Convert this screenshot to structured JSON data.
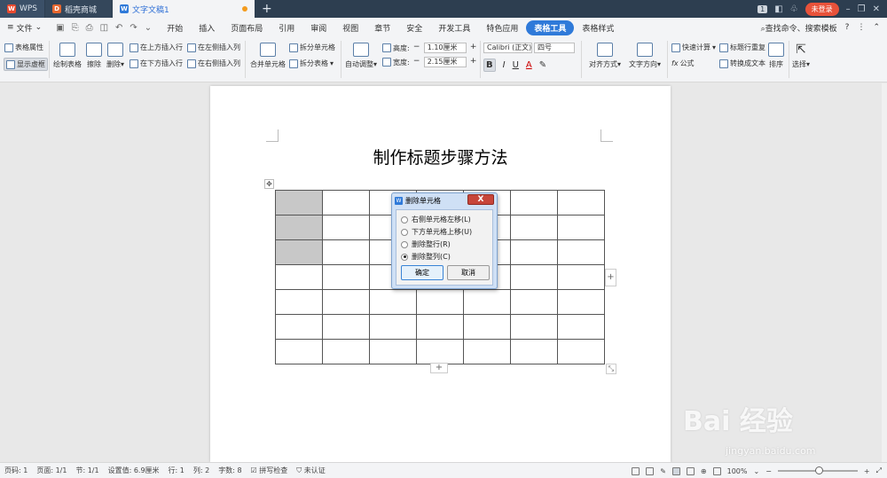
{
  "titlebar": {
    "tabs": [
      {
        "label": "WPS",
        "icon": "wps-logo-icon"
      },
      {
        "label": "稻壳商城",
        "icon": "docer-logo-icon"
      },
      {
        "label": "文字文稿1",
        "icon": "writer-doc-icon"
      }
    ],
    "badge": "1",
    "login_label": "未登录"
  },
  "menubar": {
    "file_label": "文件",
    "items": [
      "开始",
      "插入",
      "页面布局",
      "引用",
      "审阅",
      "视图",
      "章节",
      "安全",
      "开发工具",
      "特色应用",
      "表格工具",
      "表格样式"
    ],
    "active": "表格工具",
    "search_label": "查找命令、搜索模板"
  },
  "ribbon": {
    "table_props": "表格属性",
    "show_gridlines": "显示虚框",
    "draw_table": "绘制表格",
    "eraser": "擦除",
    "delete": "删除",
    "insert_above": "在上方插入行",
    "insert_below": "在下方插入行",
    "insert_left": "在左侧插入列",
    "insert_right": "在右侧插入列",
    "merge_cells": "合并单元格",
    "split_cells": "拆分单元格",
    "split_table": "拆分表格",
    "auto_fit": "自动调整",
    "height_label": "高度:",
    "height_value": "1.10厘米",
    "width_label": "宽度:",
    "width_value": "2.15厘米",
    "font_name": "Calibri (正文)",
    "font_size": "四号",
    "bold": "B",
    "italic": "I",
    "underline": "U",
    "font_color": "A",
    "align": "对齐方式",
    "text_direction": "文字方向",
    "quick_calc": "快速计算",
    "repeat_header": "标题行重复",
    "formula": "公式",
    "convert_text": "转换成文本",
    "sort": "排序",
    "select": "选择"
  },
  "document": {
    "title": "制作标题步骤方法",
    "table": {
      "rows": 7,
      "cols": 7,
      "selected": [
        [
          0,
          0
        ],
        [
          1,
          0
        ],
        [
          2,
          0
        ]
      ]
    }
  },
  "dialog": {
    "title": "删除单元格",
    "close": "X",
    "options": [
      {
        "label": "右侧单元格左移(L)",
        "checked": false
      },
      {
        "label": "下方单元格上移(U)",
        "checked": false
      },
      {
        "label": "删除整行(R)",
        "checked": false
      },
      {
        "label": "删除整列(C)",
        "checked": true
      }
    ],
    "ok_label": "确定",
    "cancel_label": "取消"
  },
  "statusbar": {
    "page_num": "页码: 1",
    "pages": "页面: 1/1",
    "section": "节: 1/1",
    "setting": "设置值: 6.9厘米",
    "row": "行: 1",
    "col": "列: 2",
    "words": "字数: 8",
    "spell": "拼写检查",
    "auth": "未认证",
    "zoom": "100%"
  },
  "watermark": {
    "logo": "Bai 经验",
    "url": "jingyan.baidu.com"
  }
}
